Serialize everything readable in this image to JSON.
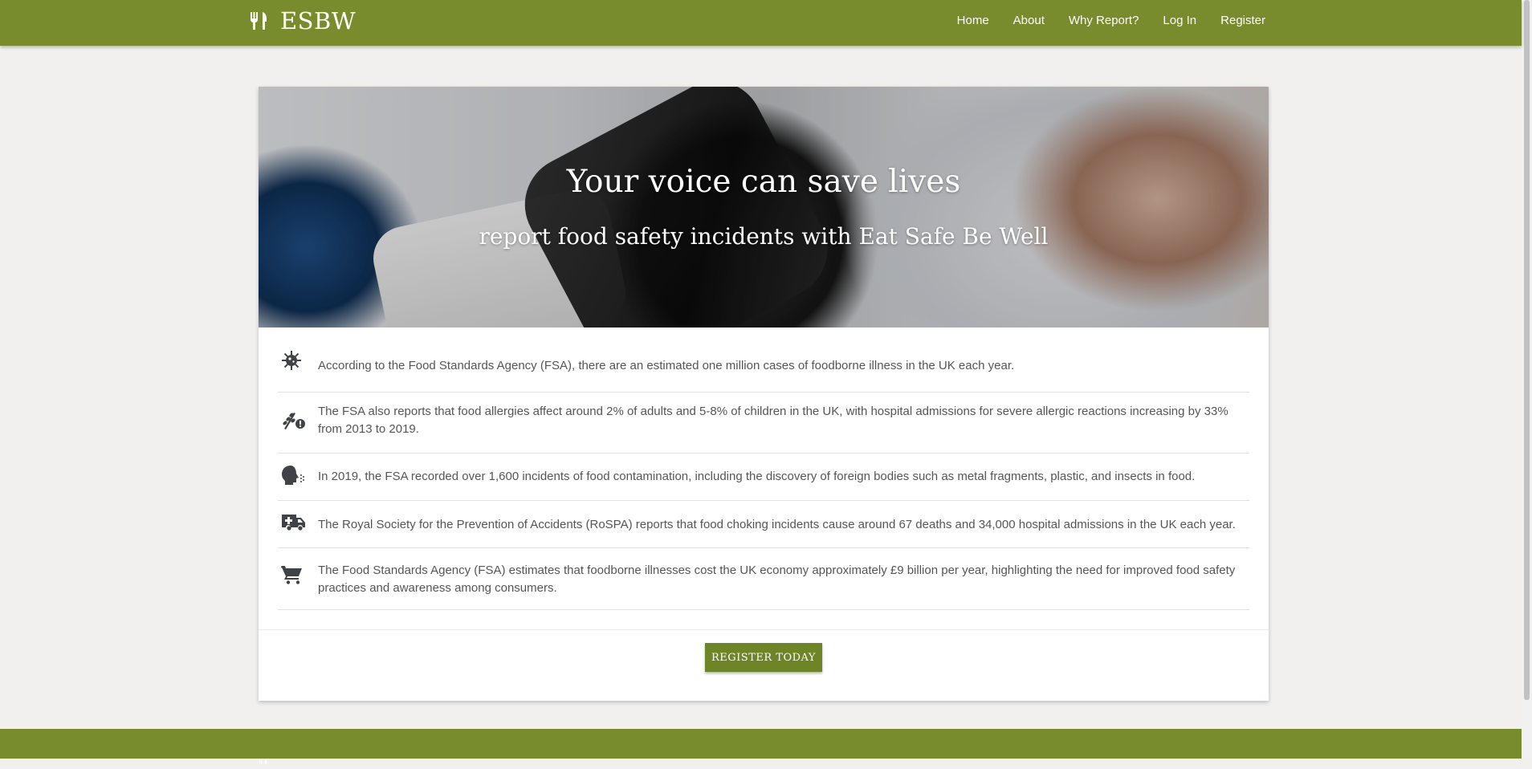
{
  "colors": {
    "brand": "#788b2d",
    "button": "#6e8527",
    "icon": "#3f4347",
    "page_bg": "#f1f0ef"
  },
  "navbar": {
    "brand_icon": "cutlery-icon",
    "brand": "ESBW",
    "links": [
      "Home",
      "About",
      "Why Report?",
      "Log In",
      "Register"
    ]
  },
  "hero": {
    "title": "Your voice can save lives",
    "subtitle": "report food safety incidents with Eat Safe Be Well"
  },
  "facts": [
    {
      "icon": "virus-icon",
      "text": "According to the Food Standards Agency (FSA), there are an estimated one million cases of foodborne illness in the UK each year."
    },
    {
      "icon": "allergy-warning-icon",
      "text": "The FSA also reports that food allergies affect around 2% of adults and 5-8% of children in the UK, with hospital admissions for severe allergic reactions increasing by 33% from 2013 to 2019."
    },
    {
      "icon": "head-cough-icon",
      "text": "In 2019, the FSA recorded over 1,600 incidents of food contamination, including the discovery of foreign bodies such as metal fragments, plastic, and insects in food."
    },
    {
      "icon": "ambulance-icon",
      "text": "The Royal Society for the Prevention of Accidents (RoSPA) reports that food choking incidents cause around 67 deaths and 34,000 hospital admissions in the UK each year."
    },
    {
      "icon": "shopping-cart-icon",
      "text": "The Food Standards Agency (FSA) estimates that foodborne illnesses cost the UK economy approximately £9 billion per year, highlighting the need for improved food safety practices and awareness among consumers."
    }
  ],
  "cta": {
    "label": "REGISTER TODAY"
  }
}
